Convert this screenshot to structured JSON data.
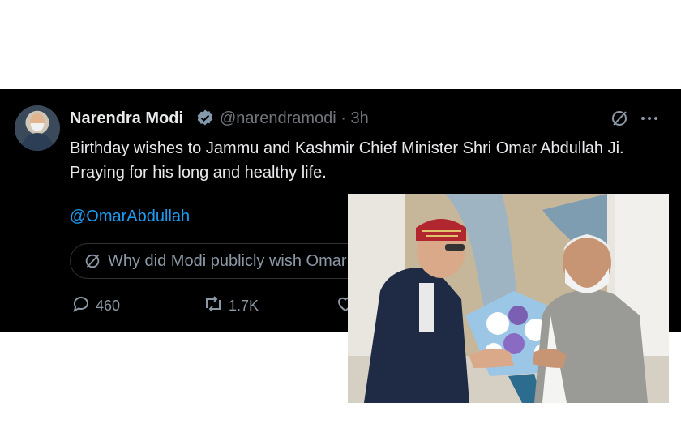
{
  "tweet": {
    "author_name": "Narendra Modi",
    "handle_time": "@narendramodi · 3h",
    "text": "Birthday wishes to Jammu and Kashmir Chief Minister Shri Omar Abdullah Ji. Praying for his long and healthy life.",
    "mention": "@OmarAbdullah",
    "grok_prompt": "Why did Modi publicly wish Omar Abdullah",
    "replies": "460",
    "reposts": "1.7K"
  },
  "icons": {
    "verified": "verified-badge-icon",
    "grok": "grok-icon",
    "more": "more-icon",
    "reply": "reply-icon",
    "repost": "repost-icon",
    "like": "like-icon"
  },
  "colors": {
    "background": "#000000",
    "text": "#e7e9ea",
    "muted": "#71767b",
    "link": "#1d9bf0"
  }
}
